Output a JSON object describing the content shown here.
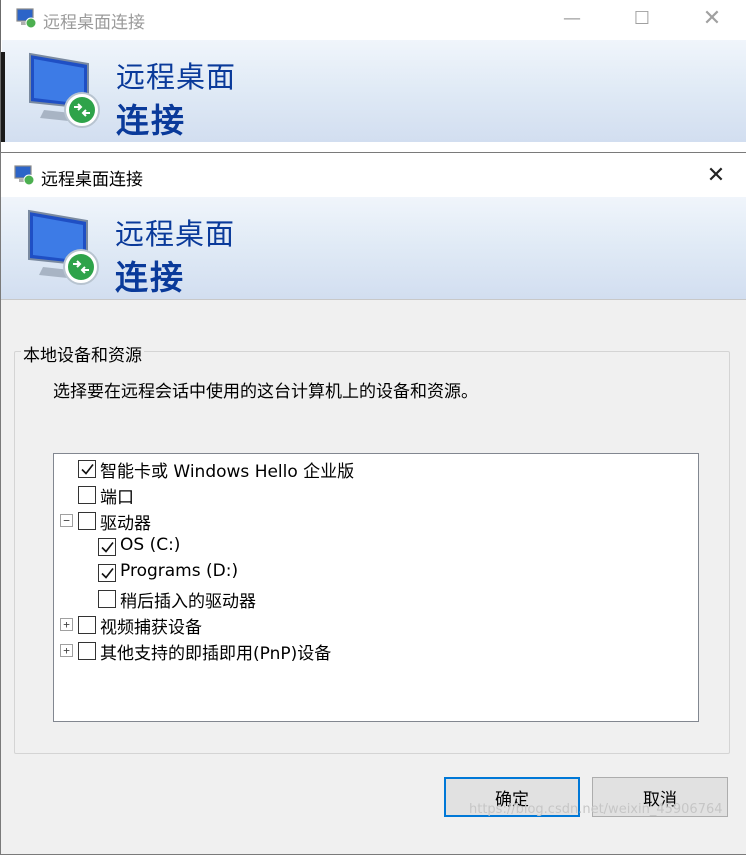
{
  "background_window": {
    "title": "远程桌面连接",
    "banner_line1": "远程桌面",
    "banner_line2": "连接"
  },
  "dialog": {
    "title": "远程桌面连接",
    "banner_line1": "远程桌面",
    "banner_line2": "连接",
    "group_title": "本地设备和资源",
    "group_description": "选择要在远程会话中使用的这台计算机上的设备和资源。",
    "tree": [
      {
        "label": "智能卡或 Windows Hello 企业版",
        "checked": true,
        "expander": null,
        "level": 0
      },
      {
        "label": "端口",
        "checked": false,
        "expander": null,
        "level": 0
      },
      {
        "label": "驱动器",
        "checked": false,
        "expander": "minus",
        "level": 0
      },
      {
        "label": "OS (C:)",
        "checked": true,
        "expander": null,
        "level": 1
      },
      {
        "label": "Programs (D:)",
        "checked": true,
        "expander": null,
        "level": 1
      },
      {
        "label": "稍后插入的驱动器",
        "checked": false,
        "expander": null,
        "level": 1
      },
      {
        "label": "视频捕获设备",
        "checked": false,
        "expander": "plus",
        "level": 0
      },
      {
        "label": "其他支持的即插即用(PnP)设备",
        "checked": false,
        "expander": "plus",
        "level": 0
      }
    ],
    "ok_label": "确定",
    "cancel_label": "取消",
    "watermark": "https://blog.csdn.net/weixin_45906764"
  },
  "colors": {
    "banner_text": "#0a3a9a",
    "focus_border": "#0078d7"
  },
  "icons": [
    "remote-desktop-icon",
    "minimize-icon",
    "maximize-icon",
    "close-icon",
    "checkmark-icon",
    "expand-icon",
    "collapse-icon"
  ]
}
